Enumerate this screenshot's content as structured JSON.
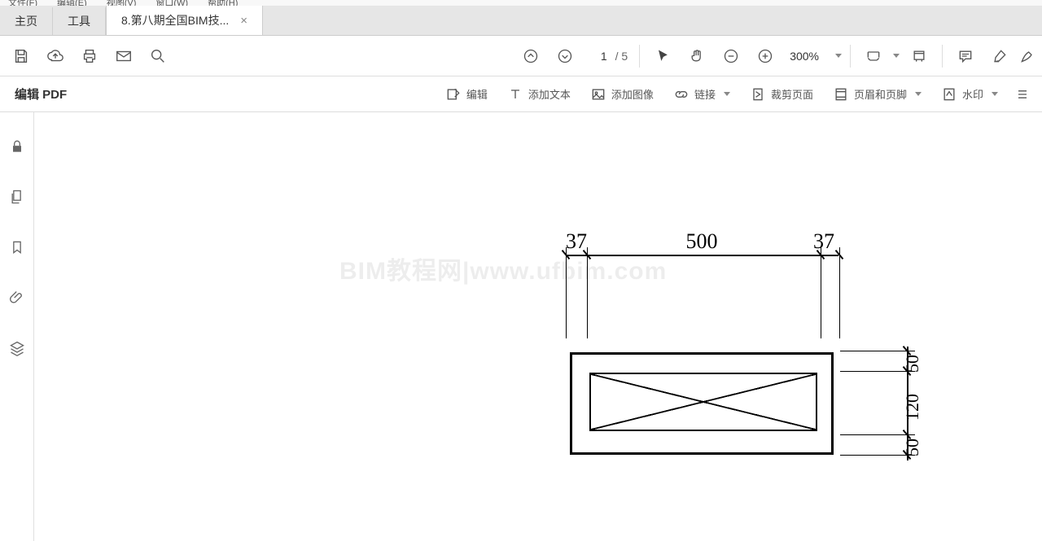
{
  "menu": {
    "file": "文件(F)",
    "edit": "编辑(E)",
    "view": "视图(V)",
    "window": "窗口(W)",
    "help": "帮助(H)"
  },
  "tabs": {
    "home": "主页",
    "tools": "工具",
    "doc_title": "8.第八期全国BIM技..."
  },
  "page": {
    "current": "1",
    "total": "/ 5"
  },
  "zoom": "300%",
  "edit_pdf_label": "编辑 PDF",
  "edit_actions": {
    "edit": "编辑",
    "add_text": "添加文本",
    "add_image": "添加图像",
    "link": "链接",
    "crop": "裁剪页面",
    "header_footer": "页眉和页脚",
    "watermark": "水印"
  },
  "drawing": {
    "dim_left": "37",
    "dim_center": "500",
    "dim_right": "37",
    "dim_v_top": "50",
    "dim_v_mid": "120",
    "dim_v_bot": "50"
  },
  "watermark_text": "BIM教程网|www.ufbim.com"
}
